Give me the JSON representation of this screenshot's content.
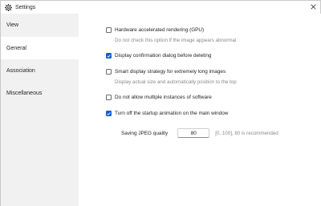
{
  "window": {
    "title": "Settings"
  },
  "sidebar": {
    "items": [
      {
        "label": "View",
        "active": false
      },
      {
        "label": "General",
        "active": true
      },
      {
        "label": "Association",
        "active": false
      },
      {
        "label": "Miscellaneous",
        "active": false
      }
    ]
  },
  "general": {
    "options": [
      {
        "label": "Hardware accelerated rendering (GPU)",
        "checked": false,
        "hint": "Do not check this option if the image appears abnormal"
      },
      {
        "label": "Display confirmation dialog before deleting",
        "checked": true,
        "hint": ""
      },
      {
        "label": "Smart display strategy for extremely long images",
        "checked": false,
        "hint": "Display actual size and automatically position to the top"
      },
      {
        "label": "Do not allow multiple instances of software",
        "checked": false,
        "hint": ""
      },
      {
        "label": "Turn off the startup animation on the main window",
        "checked": true,
        "hint": ""
      }
    ],
    "jpeg_quality": {
      "label": "Saving JPEG quality",
      "value": "80",
      "hint": "[0..100], 80 is recommended"
    }
  },
  "colors": {
    "accent": "#0f62c8",
    "sidebar_bg": "#f1f1f1",
    "hint_text": "#8a8a8a"
  }
}
